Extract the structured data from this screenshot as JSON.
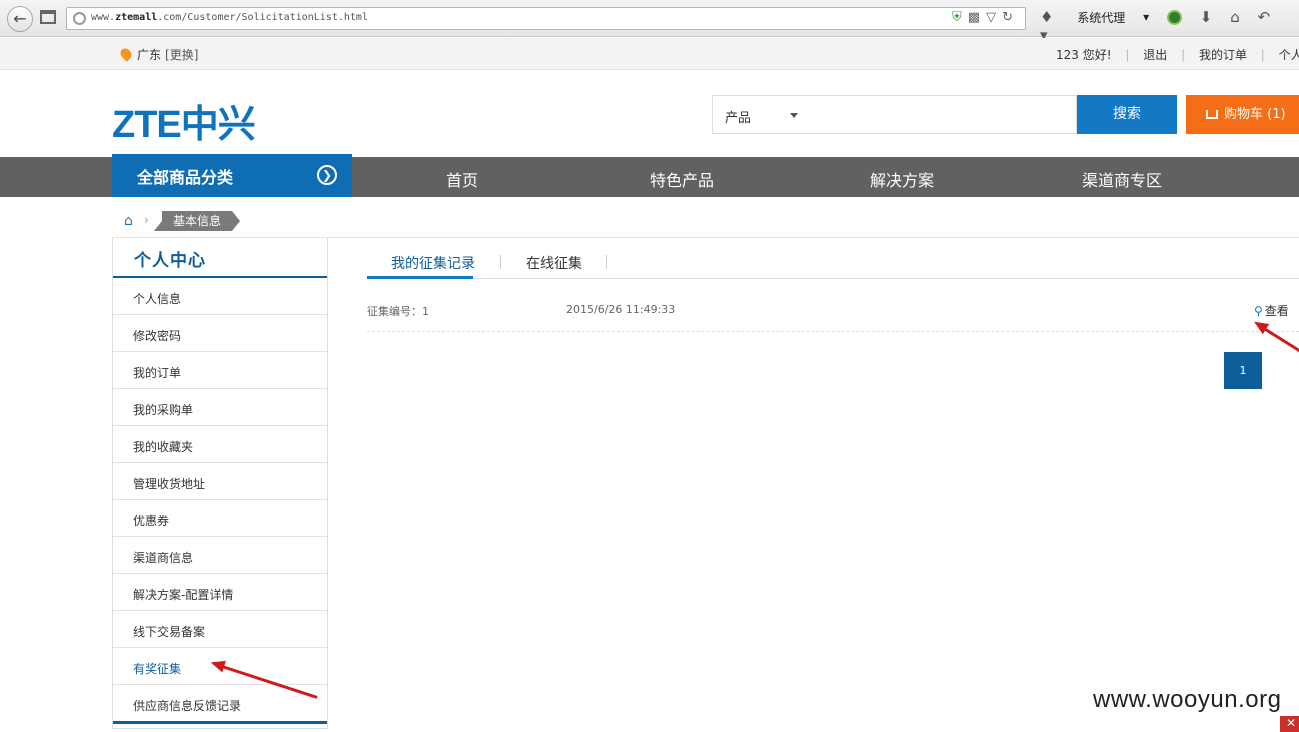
{
  "browser": {
    "url_prefix": "www.",
    "url_host": "ztemall",
    "url_rest": ".com/Customer/SolicitationList.html",
    "proxy_label": "系统代理"
  },
  "topbar": {
    "location": "广东",
    "change_label": "[更换]",
    "greeting": "123 您好!",
    "logout": "退出",
    "my_orders": "我的订单",
    "personal_info": "个人信息"
  },
  "header": {
    "logo_text": "ZTE中兴",
    "search_category": "产品",
    "search_button": "搜索",
    "cart_label": "购物车 (1)"
  },
  "nav": {
    "all_categories": "全部商品分类",
    "items": [
      "首页",
      "特色产品",
      "解决方案",
      "渠道商专区"
    ]
  },
  "breadcrumb": {
    "current": "基本信息"
  },
  "sidebar": {
    "title": "个人中心",
    "items": [
      "个人信息",
      "修改密码",
      "我的订单",
      "我的采购单",
      "我的收藏夹",
      "管理收货地址",
      "优惠券",
      "渠道商信息",
      "解决方案-配置详情",
      "线下交易备案",
      "有奖征集",
      "供应商信息反馈记录"
    ],
    "active_index": 10
  },
  "content": {
    "tabs": [
      "我的征集记录",
      "在线征集"
    ],
    "record_label": "征集编号：1",
    "record_time": "2015/6/26 11:49:33",
    "view_label": "查看",
    "page_number": "1"
  },
  "watermark": "www.wooyun.org",
  "colors": {
    "brand_blue": "#0f74bb",
    "search_blue": "#1479c4",
    "cart_orange": "#f56e17",
    "nav_gray": "#616161",
    "annotation_red": "#d0191b"
  }
}
